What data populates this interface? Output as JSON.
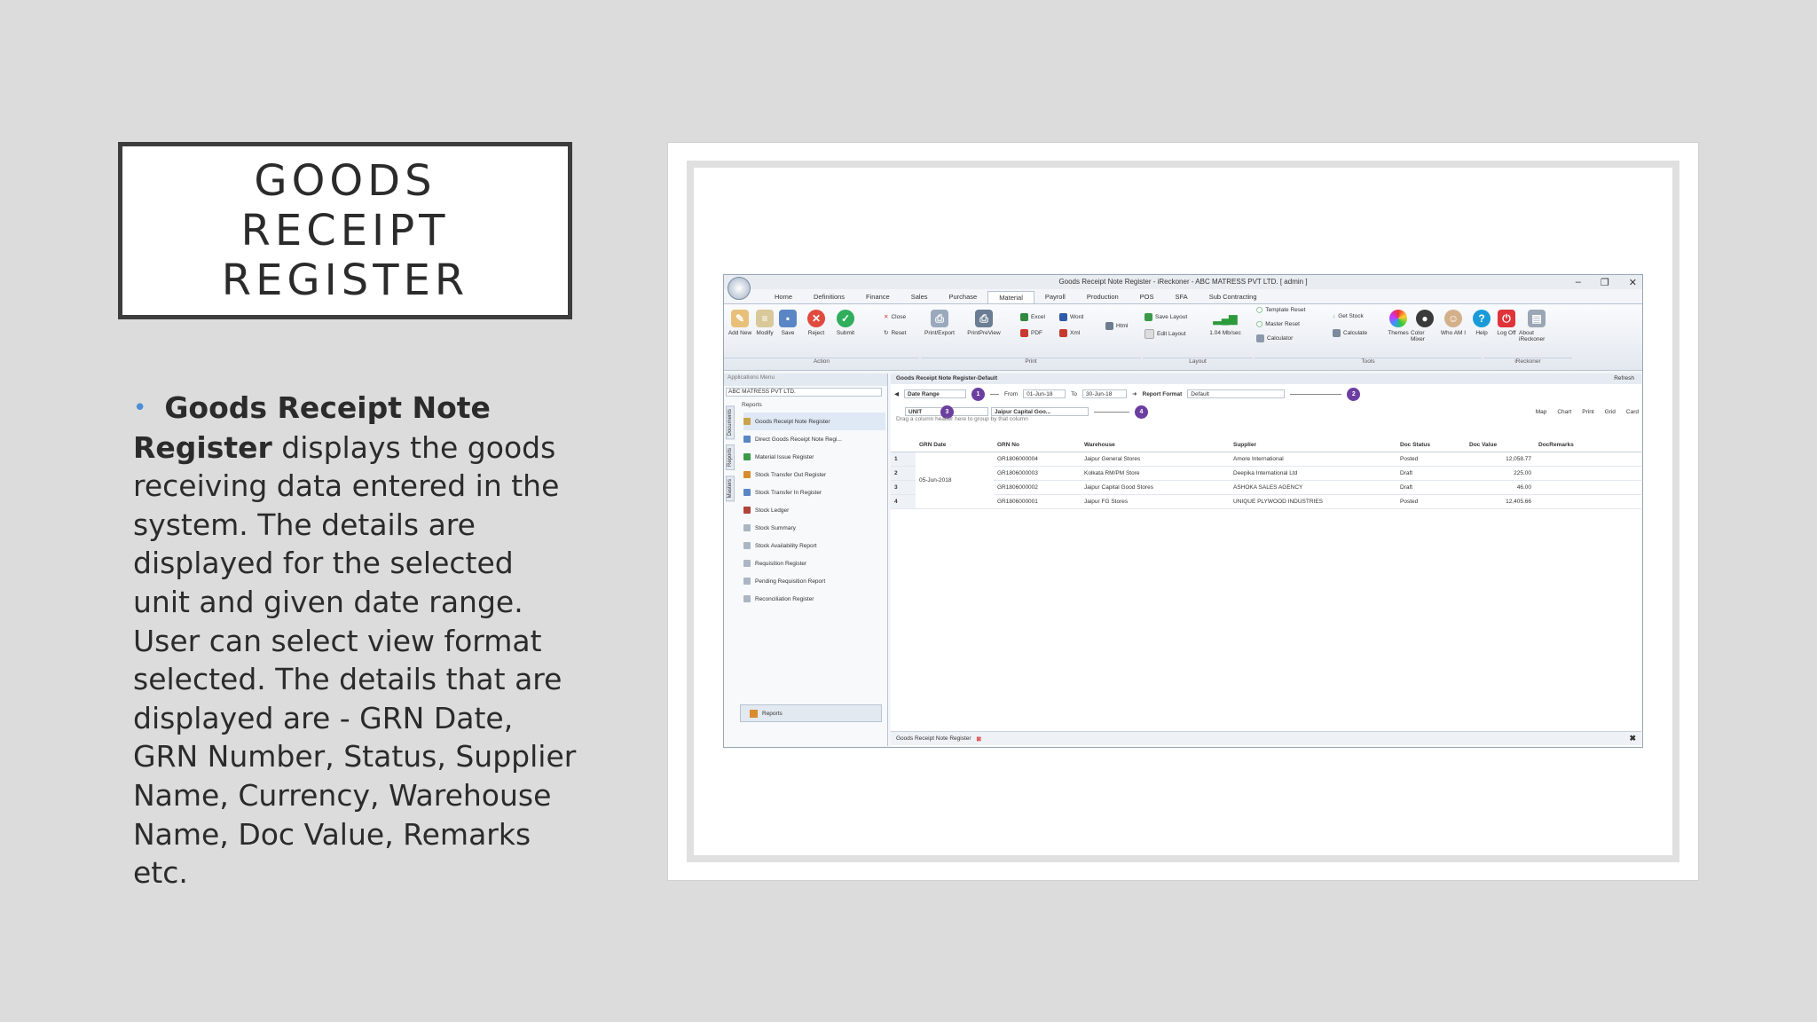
{
  "slide": {
    "title_line1": "GOODS RECEIPT",
    "title_line2": "REGISTER",
    "bullet_bold": "Goods Receipt Note Register",
    "bullet_text": " displays the goods receiving data entered in the system. The details are displayed for the selected unit and given date range. User can select view format selected. The details that are displayed are - GRN Date, GRN Number, Status, Supplier Name, Currency, Warehouse Name, Doc Value, Remarks etc."
  },
  "app": {
    "window_title": "Goods Receipt Note Register - iReckoner - ABC MATRESS PVT LTD. [ admin ]",
    "tabs": [
      "Home",
      "Definitions",
      "Finance",
      "Sales",
      "Purchase",
      "Material",
      "Payroll",
      "Production",
      "POS",
      "SFA",
      "Sub Contracting"
    ],
    "active_tab": "Material",
    "ribbon_buttons": [
      "Add New",
      "Modify",
      "Save",
      "Reject",
      "Submit",
      "Print/Export",
      "PrintPreView",
      "Html",
      "Themes",
      "Color Mixer",
      "Who AM I",
      "Help",
      "Log Off",
      "About iReckoner"
    ],
    "ribbon_small": {
      "close": "Close",
      "reset": "Reset",
      "excel": "Excel",
      "word": "Word",
      "pdf": "PDF",
      "xml": "Xml",
      "save_layout": "Save Layout",
      "edit_layout": "Edit Layout",
      "speed": "1.04 Mb/sec",
      "template_reset": "Template Reset",
      "master_reset": "Master Reset",
      "calculator": "Calculator",
      "get_stock": "Get Stock",
      "calculate": "Calculate"
    },
    "ribbon_groups": {
      "action": "Action",
      "print": "Print",
      "layout": "Layout",
      "tools": "Tools",
      "ireckoner": "iReckoner"
    },
    "sidepanel": {
      "header": "Applications Menu",
      "company": "ABC MATRESS PVT LTD.",
      "section": "Reports",
      "vtabs": [
        "Documents",
        "Reports",
        "Masters"
      ],
      "items": [
        "Goods Receipt Note Register",
        "Direct Goods Receipt Note Regi...",
        "Material Issue Register",
        "Stock Transfer Out Register",
        "Stock Transfer In Register",
        "Stock Ledger",
        "Stock Summary",
        "Stock Availability Report",
        "Requisition Register",
        "Pending Requisition Report",
        "Reconciliation Register"
      ],
      "footer": "Reports"
    },
    "main": {
      "header": "Goods Receipt Note Register-Default",
      "refresh": "Refresh",
      "date_range_label": "Date Range",
      "from_label": "From",
      "from_value": "01-Jun-18",
      "to_label": "To",
      "to_value": "30-Jun-18",
      "report_format_label": "Report Format",
      "report_format_value": "Default",
      "unit_label": "UNIT",
      "unit_value": "Jaipur Capital Goo...",
      "right_buttons": [
        "Map",
        "Chart",
        "Print",
        "Grid",
        "Card"
      ],
      "badges": [
        "1",
        "2",
        "3",
        "4"
      ],
      "group_hint": "Drag a column header here to group by that column",
      "columns": [
        "GRN Date",
        "GRN No",
        "Warehouse",
        "Supplier",
        "Doc Status",
        "Doc Value",
        "DocRemarks"
      ],
      "row_date": "05-Jun-2018",
      "rows": [
        {
          "n": "1",
          "grn": "GR1806000004",
          "wh": "Jaipur General Stores",
          "sup": "Amore International",
          "status": "Posted",
          "value": "12,058.77"
        },
        {
          "n": "2",
          "grn": "GR1806000003",
          "wh": "Kolkata RM/PM Store",
          "sup": "Deepika International Ltd",
          "status": "Draft",
          "value": "225.00"
        },
        {
          "n": "3",
          "grn": "GR1806000002",
          "wh": "Jaipur Capital Good Stores",
          "sup": "ASHOKA SALES AGENCY",
          "status": "Draft",
          "value": "46.00"
        },
        {
          "n": "4",
          "grn": "GR1806000001",
          "wh": "Jaipur FG Stores",
          "sup": "UNIQUE PLYWOOD INDUSTRIES",
          "status": "Posted",
          "value": "12,405.66"
        }
      ],
      "bottom_tab": "Goods Receipt Note Register"
    }
  }
}
